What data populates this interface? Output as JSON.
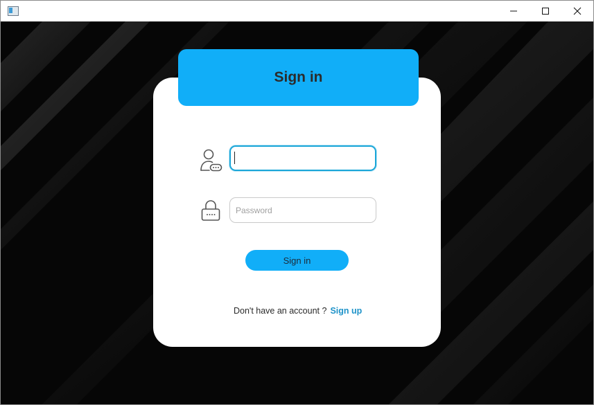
{
  "window": {
    "controls": {
      "minimize_icon": "minimize-icon",
      "maximize_icon": "maximize-icon",
      "close_icon": "close-icon"
    }
  },
  "login": {
    "title": "Sign in",
    "username": {
      "value": "",
      "placeholder": ""
    },
    "password": {
      "value": "",
      "placeholder": "Password"
    },
    "submit_label": "Sign in",
    "signup_prompt": "Don't have an account ?",
    "signup_link": "Sign up"
  },
  "colors": {
    "accent": "#11aef8",
    "link": "#1f93c9",
    "background": "#050505",
    "card": "#ffffff"
  }
}
